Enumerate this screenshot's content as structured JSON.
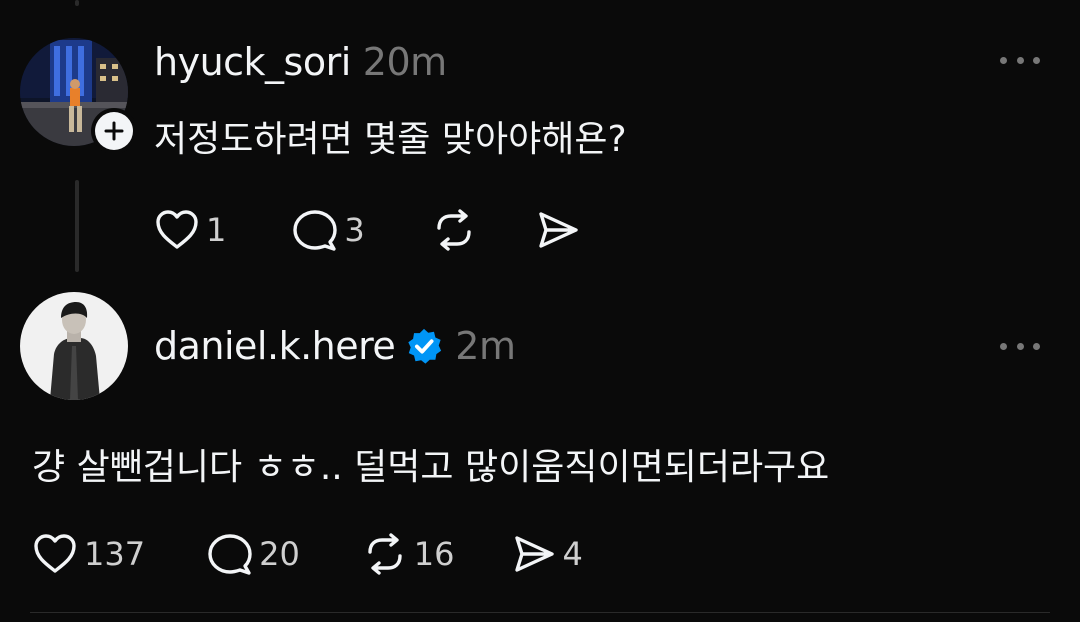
{
  "posts": [
    {
      "username": "hyuck_sori",
      "time": "20m",
      "text": "저정도하려면 몇줄 맞아야해욘?",
      "likes": "1",
      "comments": "3",
      "reposts": "",
      "shares": "",
      "avatar_icon": "night-street-photo",
      "follow_icon": "plus-icon"
    },
    {
      "username": "daniel.k.here",
      "verified": true,
      "verified_color": "#0095f6",
      "time": "2m",
      "text": "걍 살뺀겁니다 ㅎㅎ.. 덜먹고 많이움직이면되더라구요",
      "likes": "137",
      "comments": "20",
      "reposts": "16",
      "shares": "4",
      "avatar_icon": "person-bw-photo"
    }
  ]
}
